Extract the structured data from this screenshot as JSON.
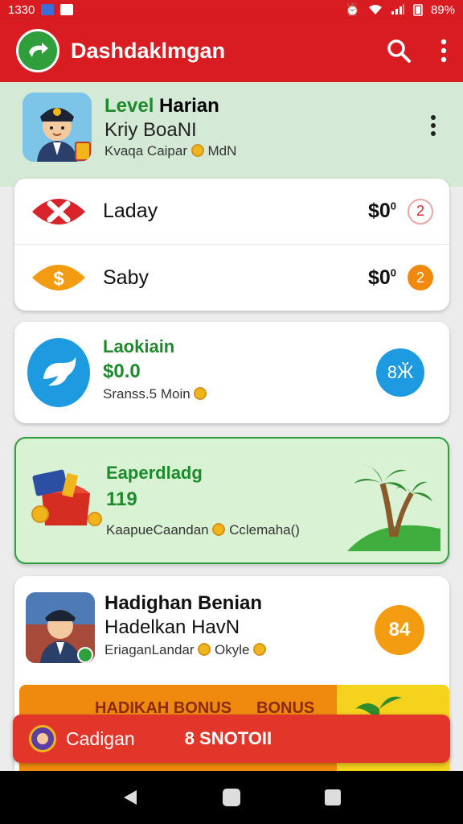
{
  "status_bar": {
    "time": "1330",
    "battery": "89%"
  },
  "app_bar": {
    "title": "Dashdaklmgan"
  },
  "header": {
    "title_green": "Level",
    "title_rest": " Harian",
    "subtitle": "Kriy BoaNI",
    "meta_left": "Kvaqa Caipar",
    "meta_right": "MdN"
  },
  "summary": {
    "rows": [
      {
        "label": "Laday",
        "amount": "$0",
        "superscript": "0",
        "badge": "2"
      },
      {
        "label": "Saby",
        "amount": "$0",
        "superscript": "0",
        "badge": "2"
      }
    ]
  },
  "card_blue": {
    "title": "Laokiain",
    "value": "$0.0",
    "meta_left": "Sranss.5",
    "meta_right": "Moin",
    "button_label": "8Ӂ"
  },
  "card_promo": {
    "title": "Eaperdladg",
    "value": "119",
    "meta_left": "KaapueCaandan",
    "meta_right": "Cclemaha()"
  },
  "card_profile": {
    "title": "Hadighan Benian",
    "subtitle": "Hadelkan HavN",
    "meta_left": "EriaganLandar",
    "meta_right": "Okyle",
    "badge": "84"
  },
  "banner": {
    "left_label": "HADIKAH BONUS",
    "right_label": "BONUS"
  },
  "bottom_bar": {
    "label": "Cadigan",
    "action": "8 SNOTOII"
  },
  "colors": {
    "primary_red": "#d91b22",
    "green": "#1d8a2c",
    "orange": "#f39c12",
    "blue": "#1e9be0"
  }
}
